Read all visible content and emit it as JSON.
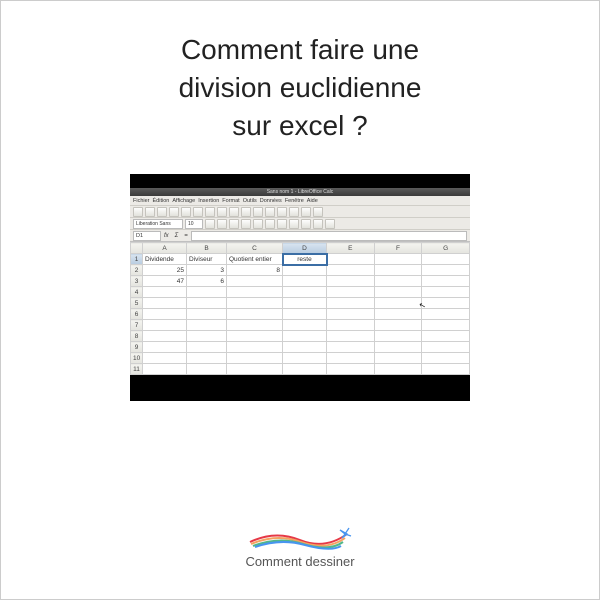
{
  "title_line1": "Comment faire une",
  "title_line2": "division euclidienne",
  "title_line3": "sur excel ?",
  "app": {
    "titlebar": "Sans nom 1 - LibreOffice Calc",
    "menu": [
      "Fichier",
      "Édition",
      "Affichage",
      "Insertion",
      "Format",
      "Outils",
      "Données",
      "Fenêtre",
      "Aide"
    ],
    "font_name": "Liberation Sans",
    "font_size": "10",
    "cell_ref": "D1",
    "columns": [
      "",
      "A",
      "B",
      "C",
      "D",
      "E",
      "F",
      "G"
    ],
    "headers": {
      "A": "Dividende",
      "B": "Diviseur",
      "C": "Quotient entier",
      "D": "reste"
    },
    "rows": [
      {
        "n": "1",
        "A": "Dividende",
        "B": "Diviseur",
        "C": "Quotient entier",
        "D": "reste"
      },
      {
        "n": "2",
        "A": "25",
        "B": "3",
        "C": "8",
        "D": ""
      },
      {
        "n": "3",
        "A": "47",
        "B": "6",
        "C": "",
        "D": ""
      },
      {
        "n": "4"
      },
      {
        "n": "5"
      },
      {
        "n": "6"
      },
      {
        "n": "7"
      },
      {
        "n": "8"
      },
      {
        "n": "9"
      },
      {
        "n": "10"
      },
      {
        "n": "11"
      }
    ]
  },
  "logo_text": "Comment dessiner"
}
